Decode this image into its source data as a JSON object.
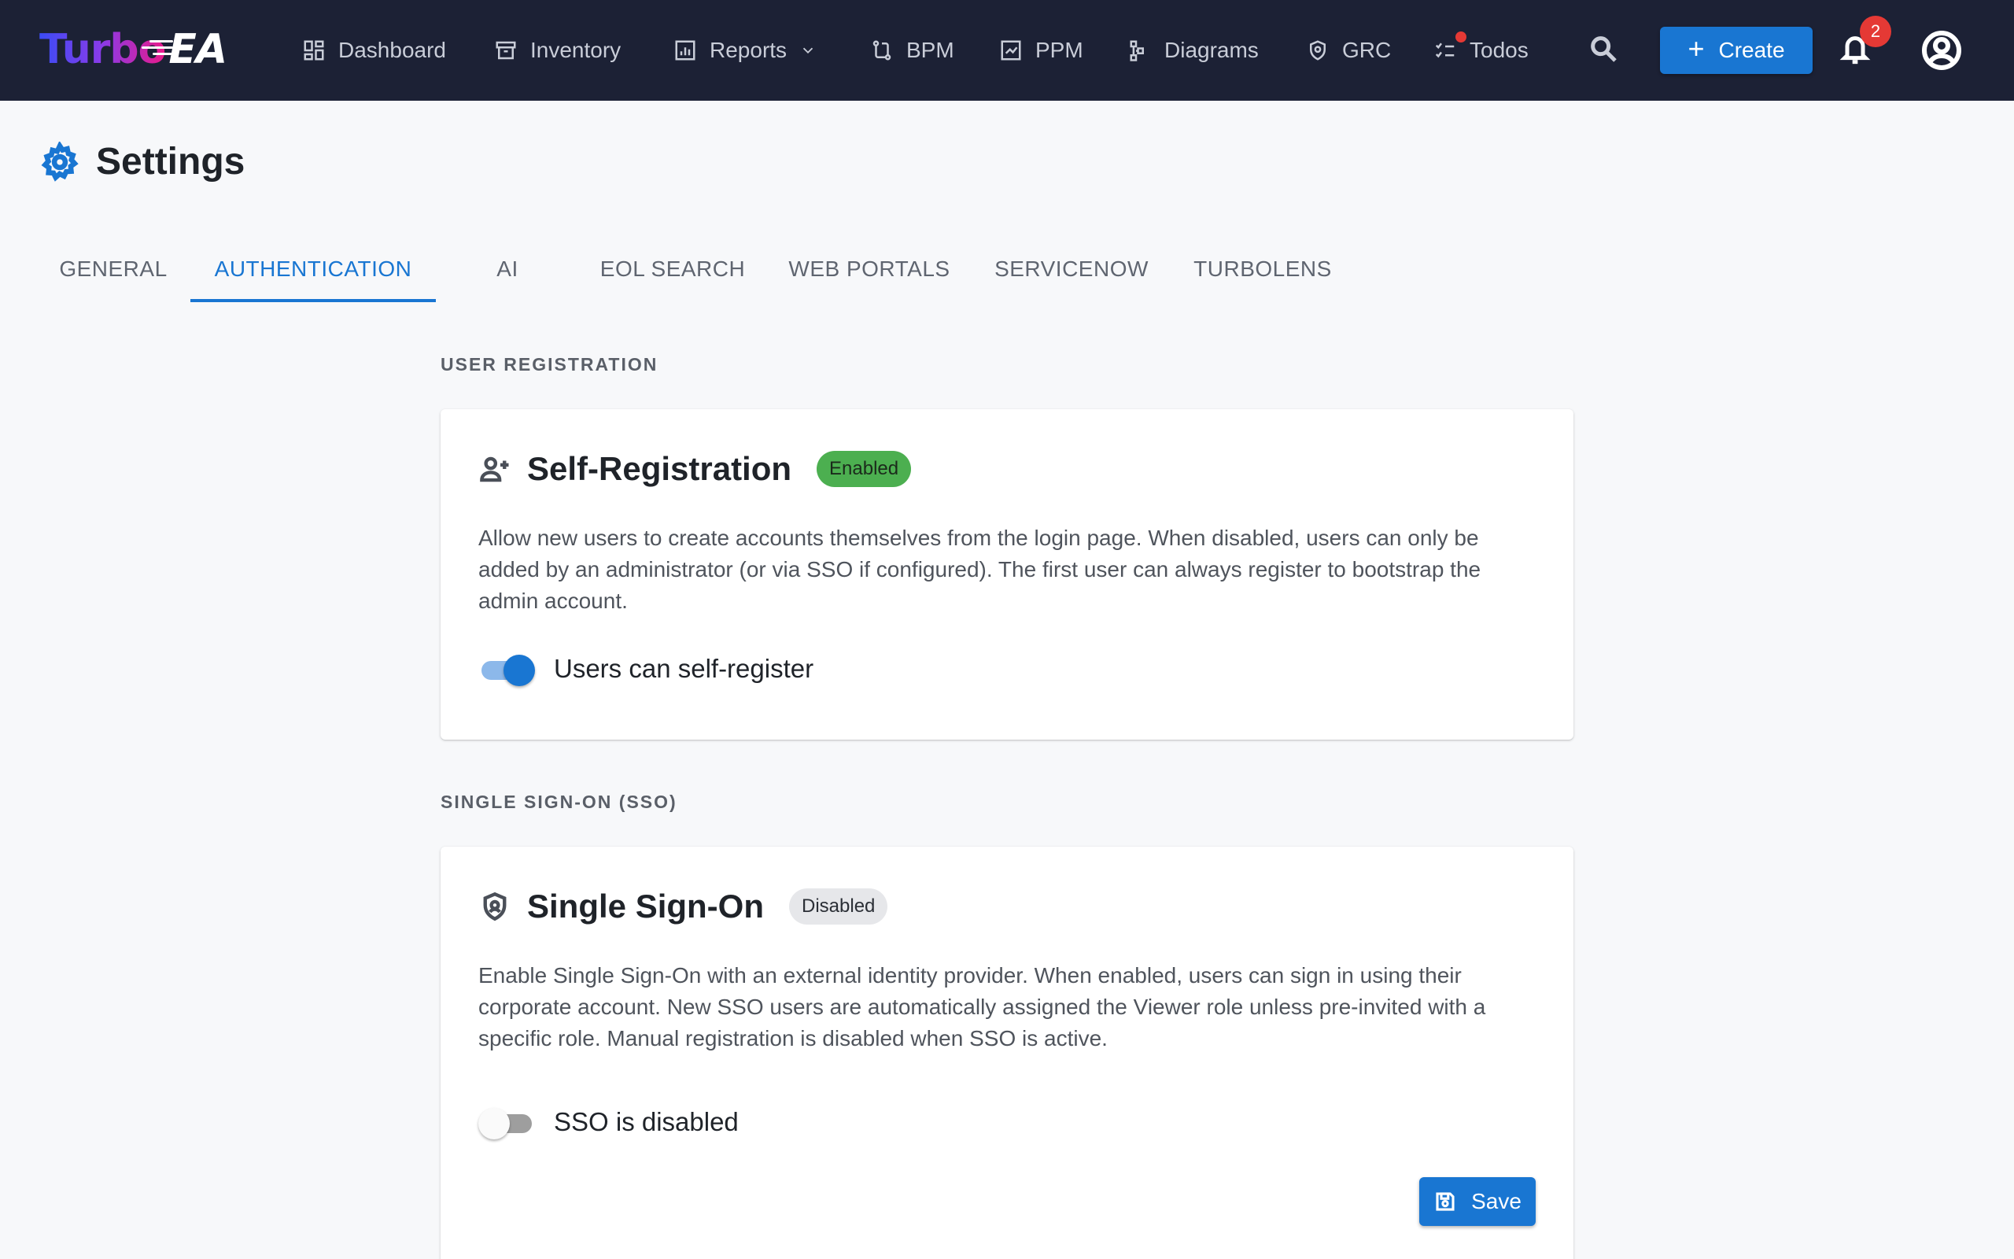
{
  "app": {
    "logo_part1": "Turbo",
    "logo_part2": "EA"
  },
  "nav": {
    "items": [
      {
        "label": "Dashboard",
        "icon": "dashboard-icon"
      },
      {
        "label": "Inventory",
        "icon": "inventory-icon"
      },
      {
        "label": "Reports",
        "icon": "reports-icon"
      },
      {
        "label": "BPM",
        "icon": "bpm-icon"
      },
      {
        "label": "PPM",
        "icon": "ppm-icon"
      },
      {
        "label": "Diagrams",
        "icon": "diagrams-icon"
      },
      {
        "label": "GRC",
        "icon": "grc-icon"
      },
      {
        "label": "Todos",
        "icon": "todos-icon"
      }
    ],
    "create_label": "Create",
    "notification_count": "2"
  },
  "page": {
    "title": "Settings"
  },
  "tabs": [
    {
      "label": "GENERAL",
      "active": false
    },
    {
      "label": "AUTHENTICATION",
      "active": true
    },
    {
      "label": "AI",
      "active": false
    },
    {
      "label": "EOL SEARCH",
      "active": false
    },
    {
      "label": "WEB PORTALS",
      "active": false
    },
    {
      "label": "SERVICENOW",
      "active": false
    },
    {
      "label": "TURBOLENS",
      "active": false
    }
  ],
  "user_registration": {
    "section_label": "USER REGISTRATION",
    "title": "Self-Registration",
    "status": "Enabled",
    "description": "Allow new users to create accounts themselves from the login page. When disabled, users can only be added by an administrator (or via SSO if configured). The first user can always register to bootstrap the admin account.",
    "toggle_label": "Users can self-register",
    "toggle_on": true
  },
  "sso": {
    "section_label": "SINGLE SIGN-ON (SSO)",
    "title": "Single Sign-On",
    "status": "Disabled",
    "description": "Enable Single Sign-On with an external identity provider. When enabled, users can sign in using their corporate account. New SSO users are automatically assigned the Viewer role unless pre-invited with a specific role. Manual registration is disabled when SSO is active.",
    "toggle_label": "SSO is disabled",
    "toggle_on": false,
    "save_label": "Save"
  },
  "colors": {
    "topbar": "#1c2135",
    "accent": "#1976d2",
    "enabled_chip": "#4caf50",
    "badge": "#e53935"
  }
}
